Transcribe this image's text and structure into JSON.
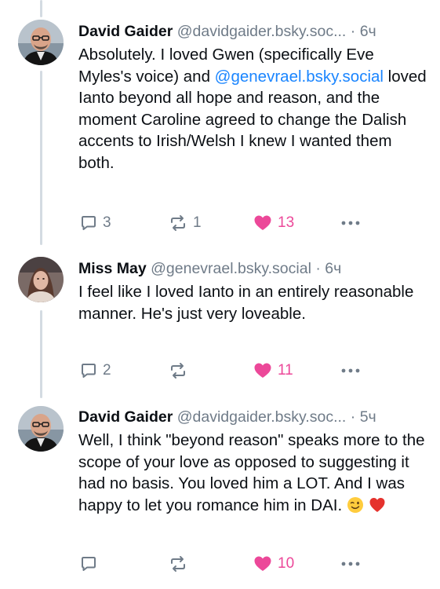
{
  "colors": {
    "accent_link": "#1a85ff",
    "like": "#ec4899",
    "muted": "#6f7b88",
    "thread_line": "#d4dbe2"
  },
  "posts": [
    {
      "author": "David Gaider",
      "handle": "@davidgaider.bsky.soc...",
      "separator": "·",
      "time": "6ч",
      "text_parts": [
        "Absolutely. I loved Gwen (specifically Eve Myles's voice) and ",
        "@genevrael.bsky.social",
        " loved Ianto beyond all hope and reason, and the moment Caroline agreed to change the Dalish accents to Irish/Welsh I knew I wanted them both."
      ],
      "replies": "3",
      "reposts": "1",
      "likes": "13",
      "liked": true,
      "avatar_icon": "avatar-bald-man"
    },
    {
      "author": "Miss May",
      "handle": "@genevrael.bsky.social",
      "separator": "·",
      "time": "6ч",
      "text": "I feel like I loved Ianto in an entirely reasonable manner. He's just very loveable.",
      "replies": "2",
      "reposts": "",
      "likes": "11",
      "liked": true,
      "avatar_icon": "avatar-woman"
    },
    {
      "author": "David Gaider",
      "handle": "@davidgaider.bsky.soc...",
      "separator": "·",
      "time": "5ч",
      "text": "Well, I think \"beyond reason\" speaks more to the scope of your love as opposed to suggesting it had no basis. You loved him a LOT. And I was happy to let you romance him in DAI.",
      "emojis": [
        "winking-face-emoji",
        "red-heart-emoji"
      ],
      "replies": "",
      "reposts": "",
      "likes": "10",
      "liked": true,
      "avatar_icon": "avatar-bald-man"
    }
  ]
}
